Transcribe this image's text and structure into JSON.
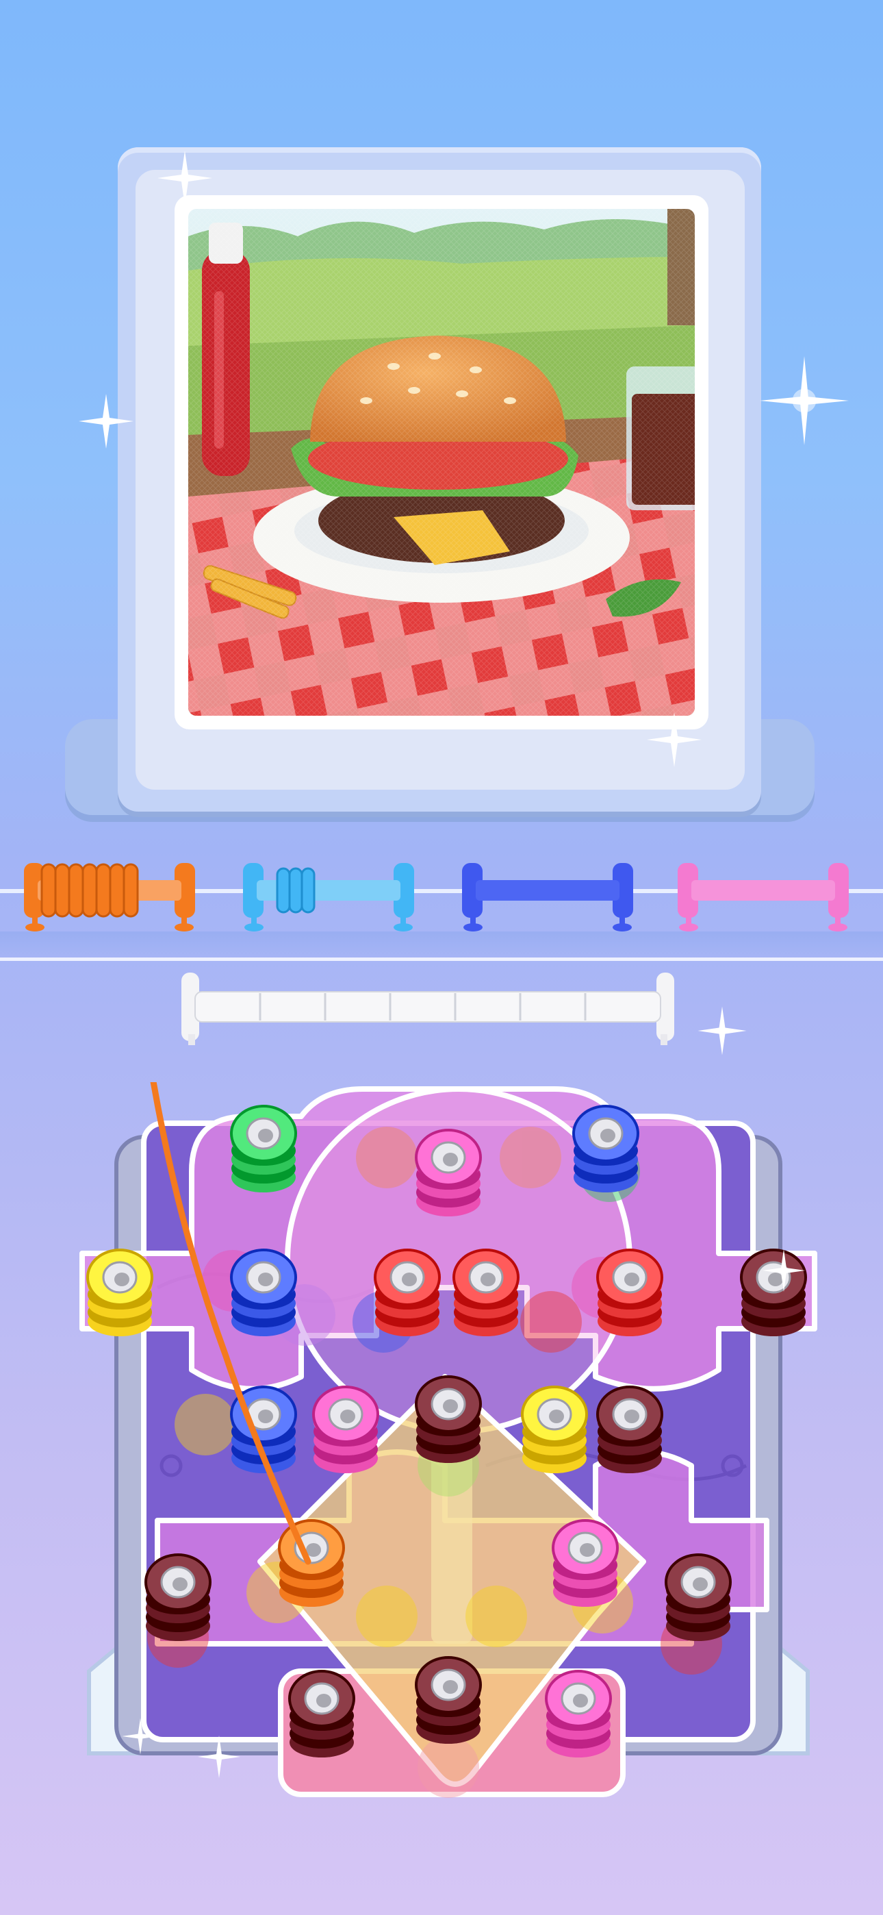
{
  "scene": {
    "picture_subject": "burger-picnic-cross-stitch",
    "colors": {
      "sky_top": "#7fb8fb",
      "sky_bottom": "#d6c6f5",
      "frame": "#c3d3f7"
    }
  },
  "spools": [
    {
      "name": "orange-spool",
      "color": "#f47a1e",
      "state": "winding"
    },
    {
      "name": "light-blue-spool",
      "color": "#42b6f5",
      "state": "partial"
    },
    {
      "name": "blue-spool",
      "color": "#3f58ef",
      "state": "empty"
    },
    {
      "name": "pink-spool",
      "color": "#f47ad0",
      "state": "empty"
    }
  ],
  "holder": {
    "slots": 7,
    "filled": 0
  },
  "pegs": [
    {
      "color": "#2fc65a",
      "layer": "top"
    },
    {
      "color": "#3b59e8",
      "layer": "top"
    },
    {
      "color": "#ec4fb3",
      "layer": "top"
    },
    {
      "color": "#f7d21e",
      "layer": "top"
    },
    {
      "color": "#3b59e8",
      "layer": "top"
    },
    {
      "color": "#e83838",
      "layer": "top"
    },
    {
      "color": "#e83838",
      "layer": "top"
    },
    {
      "color": "#e83838",
      "layer": "top"
    },
    {
      "color": "#6b1a25",
      "layer": "top"
    },
    {
      "color": "#3b59e8",
      "layer": "top"
    },
    {
      "color": "#ec4fb3",
      "layer": "top"
    },
    {
      "color": "#6b1a25",
      "layer": "top"
    },
    {
      "color": "#f7d21e",
      "layer": "top"
    },
    {
      "color": "#6b1a25",
      "layer": "top"
    },
    {
      "color": "#f47a1e",
      "layer": "top"
    },
    {
      "color": "#ec4fb3",
      "layer": "top"
    },
    {
      "color": "#6b1a25",
      "layer": "top"
    },
    {
      "color": "#6b1a25",
      "layer": "top"
    },
    {
      "color": "#6b1a25",
      "layer": "top"
    },
    {
      "color": "#6b1a25",
      "layer": "top"
    },
    {
      "color": "#ec4fb3",
      "layer": "top"
    }
  ]
}
